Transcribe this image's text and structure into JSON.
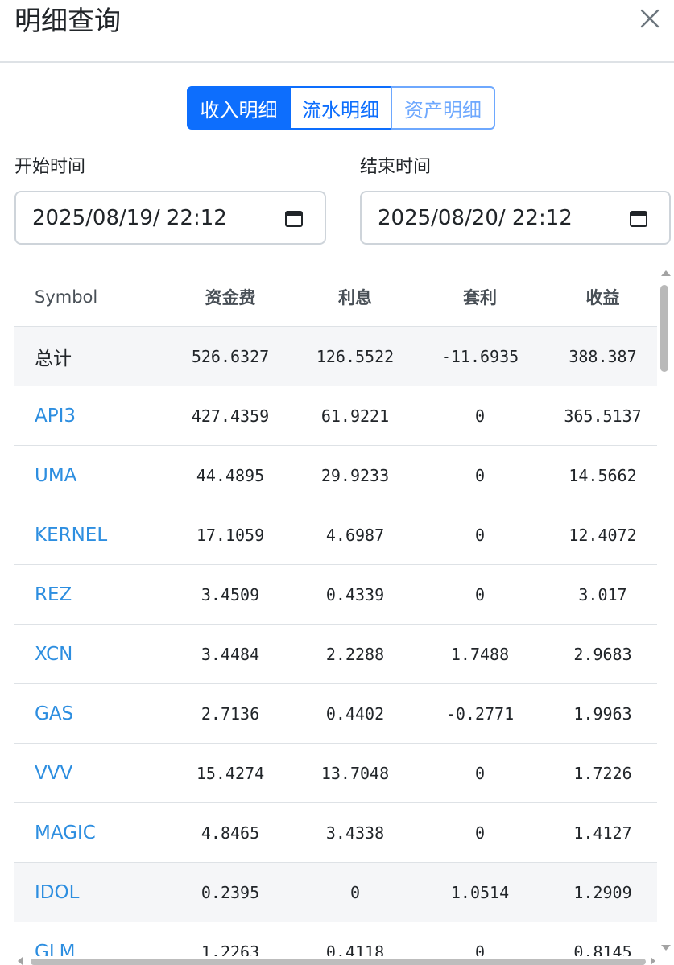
{
  "modal": {
    "title": "明细查询",
    "close_icon": "close-icon"
  },
  "tabs": [
    {
      "label": "收入明细",
      "active": true
    },
    {
      "label": "流水明细",
      "active": false
    },
    {
      "label": "资产明细",
      "active": false
    }
  ],
  "start": {
    "label": "开始时间",
    "value": "2025/08/19/ 22:12",
    "icon": "calendar-icon"
  },
  "end": {
    "label": "结束时间",
    "value": "2025/08/20/ 22:12",
    "icon": "calendar-icon"
  },
  "table": {
    "headers": [
      "Symbol",
      "资金费",
      "利息",
      "套利",
      "收益"
    ],
    "total": [
      "总计",
      "526.6327",
      "126.5522",
      "-11.6935",
      "388.387"
    ],
    "rows": [
      [
        "API3",
        "427.4359",
        "61.9221",
        "0",
        "365.5137"
      ],
      [
        "UMA",
        "44.4895",
        "29.9233",
        "0",
        "14.5662"
      ],
      [
        "KERNEL",
        "17.1059",
        "4.6987",
        "0",
        "12.4072"
      ],
      [
        "REZ",
        "3.4509",
        "0.4339",
        "0",
        "3.017"
      ],
      [
        "XCN",
        "3.4484",
        "2.2288",
        "1.7488",
        "2.9683"
      ],
      [
        "GAS",
        "2.7136",
        "0.4402",
        "-0.2771",
        "1.9963"
      ],
      [
        "VVV",
        "15.4274",
        "13.7048",
        "0",
        "1.7226"
      ],
      [
        "MAGIC",
        "4.8465",
        "3.4338",
        "0",
        "1.4127"
      ],
      [
        "IDOL",
        "0.2395",
        "0",
        "1.0514",
        "1.2909"
      ],
      [
        "GLM",
        "1.2263",
        "0.4118",
        "0",
        "0.8145"
      ]
    ]
  },
  "colors": {
    "primary": "#0d6efd",
    "link": "#2d8ee0",
    "shade": "#f5f6f8"
  }
}
